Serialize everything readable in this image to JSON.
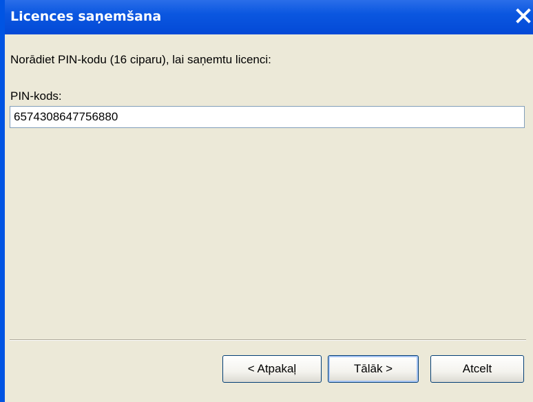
{
  "window": {
    "title": "Licences saņemšana",
    "close_icon": "close-icon"
  },
  "form": {
    "instruction": "Norādiet PIN-kodu (16 ciparu), lai saņemtu licenci:",
    "pin_label": "PIN-kods:",
    "pin_value": "6574308647756880"
  },
  "buttons": {
    "back": "< Atpakaļ",
    "next": "Tālāk >",
    "cancel": "Atcelt"
  },
  "colors": {
    "titlebar": "#0b57e0",
    "dialog_background": "#ece9d8",
    "button_border": "#003c74",
    "focus_highlight": "#a9c6f5"
  }
}
